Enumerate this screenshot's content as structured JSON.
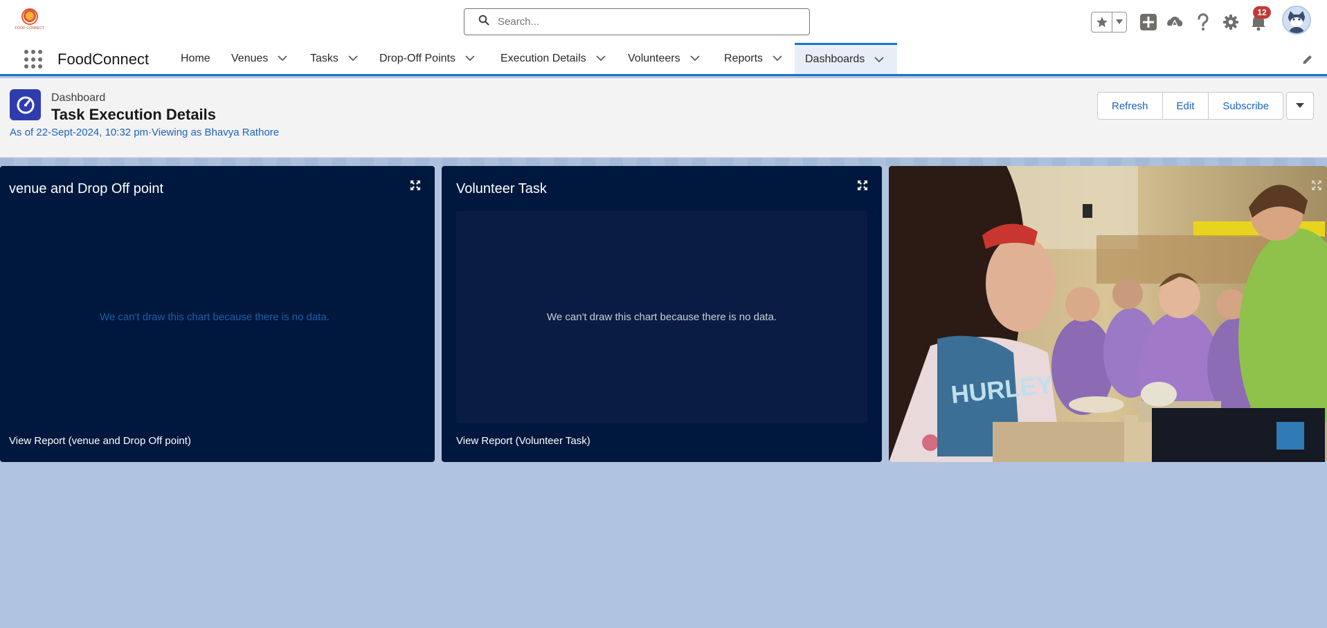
{
  "header": {
    "logo_text": "FOOD CONNECT",
    "search_placeholder": "Search...",
    "notification_count": "12"
  },
  "nav": {
    "app_name": "FoodConnect",
    "items": [
      {
        "label": "Home",
        "has_menu": false
      },
      {
        "label": "Venues",
        "has_menu": true
      },
      {
        "label": "Tasks",
        "has_menu": true
      },
      {
        "label": "Drop-Off Points",
        "has_menu": true
      },
      {
        "label": "Execution Details",
        "has_menu": true
      },
      {
        "label": "Volunteers",
        "has_menu": true
      },
      {
        "label": "Reports",
        "has_menu": true
      },
      {
        "label": "Dashboards",
        "has_menu": true,
        "active": true
      }
    ]
  },
  "page_header": {
    "object_label": "Dashboard",
    "title": "Task Execution Details",
    "subtitle": "As of 22-Sept-2024, 10:32 pm·Viewing as Bhavya Rathore",
    "buttons": [
      "Refresh",
      "Edit",
      "Subscribe"
    ]
  },
  "widgets": [
    {
      "title": "venue and Drop Off point",
      "empty_message": "We can't draw this chart because there is no data.",
      "footer_link": "View Report (venue and Drop Off point)"
    },
    {
      "title": "Volunteer Task",
      "empty_message": "We can't draw this chart because there is no data.",
      "footer_link": "View Report (Volunteer Task)"
    }
  ],
  "image_widget": {
    "image_text": "HURLEY"
  },
  "colors": {
    "brand_blue": "#1b72c9",
    "widget_bg": "#00183d",
    "canvas_bg": "#b0c4df",
    "dashboard_icon": "#2f3cad",
    "badge_red": "#c23934"
  },
  "icons": [
    "search-icon",
    "star-icon",
    "chevron-down-icon",
    "add-icon",
    "trailhead-icon",
    "help-icon",
    "gear-icon",
    "bell-icon",
    "avatar",
    "app-launcher-icon",
    "pencil-icon",
    "dashboard-icon",
    "expand-icon"
  ]
}
